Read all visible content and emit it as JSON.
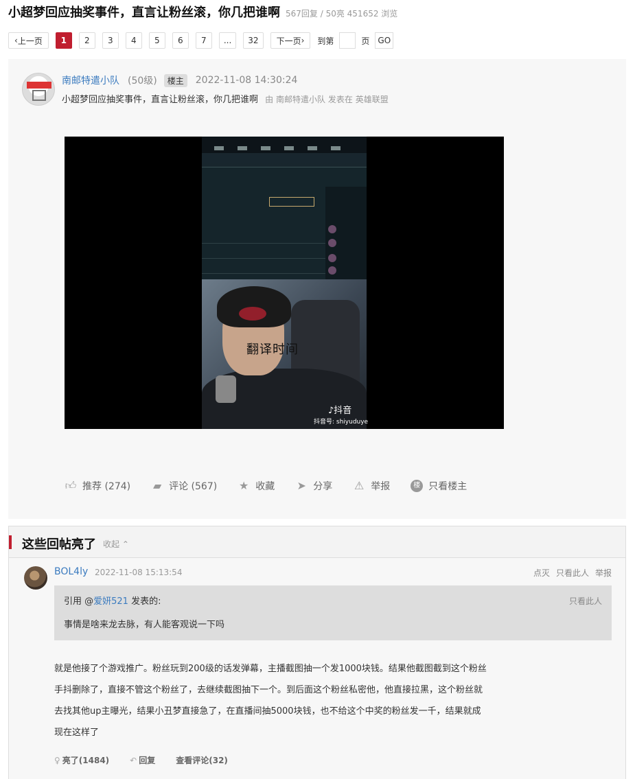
{
  "header": {
    "title": "小超梦回应抽奖事件，直言让粉丝滚，你几把谁啊",
    "meta": "567回复 / 50亮 451652 浏览"
  },
  "pagination": {
    "prev": "上一页",
    "pages": [
      "1",
      "2",
      "3",
      "4",
      "5",
      "6",
      "7",
      "...",
      "32"
    ],
    "active": "1",
    "next": "下一页",
    "goto_prefix": "到第",
    "goto_suffix": "页",
    "go": "GO"
  },
  "post": {
    "author": "南邮特遣小队",
    "level": "(50级)",
    "badge": "楼主",
    "time": "2022-11-08 14:30:24",
    "subtitle": "小超梦回应抽奖事件，直言让粉丝滚，你几把谁啊",
    "by_prefix": "由",
    "by_author": "南邮特遣小队",
    "posted_in": "发表在",
    "forum": "英雄联盟",
    "video": {
      "caption": "翻译时间",
      "logo": "抖音",
      "id": "抖音号: shiyuduye"
    },
    "actions": {
      "recommend": "推荐 (274)",
      "comment": "评论 (567)",
      "favorite": "收藏",
      "share": "分享",
      "report": "举报",
      "only_op_icon": "楼",
      "only_op": "只看楼主"
    }
  },
  "hot_replies": {
    "title": "这些回帖亮了",
    "collapse": "收起",
    "reply": {
      "author": "BOL4ly",
      "time": "2022-11-08 15:13:54",
      "tools": [
        "点灭",
        "只看此人",
        "举报"
      ],
      "quote": {
        "prefix": "引用 @",
        "user": "爱妍521",
        "suffix": " 发表的:",
        "only": "只看此人",
        "text": "事情是啥来龙去脉，有人能客观说一下吗"
      },
      "content_lines": [
        "就是他接了个游戏推广。粉丝玩到200级的话发弹幕，主播截图抽一个发1000块钱。结果他截图截到这个粉丝",
        "手抖删除了，直接不管这个粉丝了，去继续截图抽下一个。到后面这个粉丝私密他，他直接拉黑，这个粉丝就",
        "去找其他up主曝光，结果小丑梦直接急了，在直播间抽5000块钱，也不给这个中奖的粉丝发一千，结果就成",
        "现在这样了"
      ],
      "footer": {
        "light": "亮了(1484)",
        "reply": "回复",
        "view_comments": "查看评论(32)"
      }
    }
  },
  "colors": {
    "accent": "#c01e2f",
    "link": "#3b7bbf",
    "panel_bg": "#f7f7f7"
  },
  "icons": {
    "recommend": "thumbs-up-icon",
    "comment": "comment-icon",
    "favorite": "star-icon",
    "share": "share-icon",
    "report": "warning-icon",
    "light": "lightbulb-icon",
    "reply": "reply-icon"
  }
}
